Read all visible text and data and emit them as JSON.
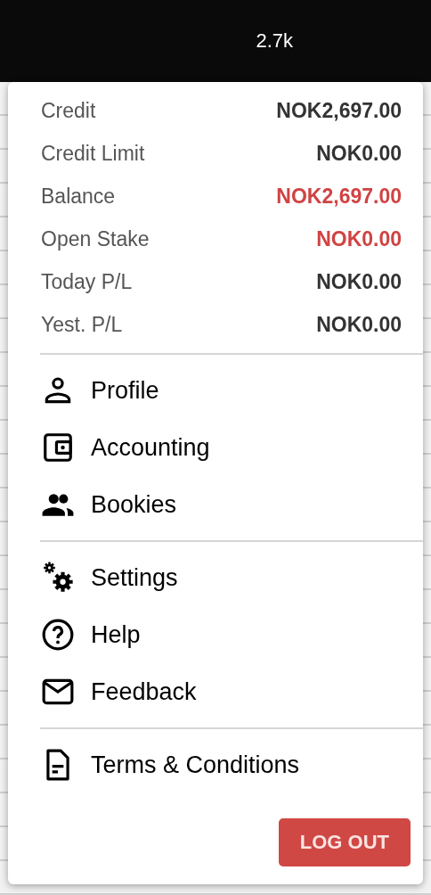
{
  "top_bar": {
    "count": "2.7k"
  },
  "account": [
    {
      "label": "Credit",
      "value": "NOK2,697.00",
      "highlight": false
    },
    {
      "label": "Credit Limit",
      "value": "NOK0.00",
      "highlight": false
    },
    {
      "label": "Balance",
      "value": "NOK2,697.00",
      "highlight": true
    },
    {
      "label": "Open Stake",
      "value": "NOK0.00",
      "highlight": true
    },
    {
      "label": "Today P/L",
      "value": "NOK0.00",
      "highlight": false
    },
    {
      "label": "Yest. P/L",
      "value": "NOK0.00",
      "highlight": false
    }
  ],
  "menu_sections": [
    [
      {
        "label": "Profile",
        "kind": "person"
      },
      {
        "label": "Accounting",
        "kind": "wallet"
      },
      {
        "label": "Bookies",
        "kind": "people"
      }
    ],
    [
      {
        "label": "Settings",
        "kind": "gears"
      },
      {
        "label": "Help",
        "kind": "help"
      },
      {
        "label": "Feedback",
        "kind": "mail"
      }
    ],
    [
      {
        "label": "Terms & Conditions",
        "kind": "document"
      }
    ]
  ],
  "logout_button": "LOG OUT"
}
